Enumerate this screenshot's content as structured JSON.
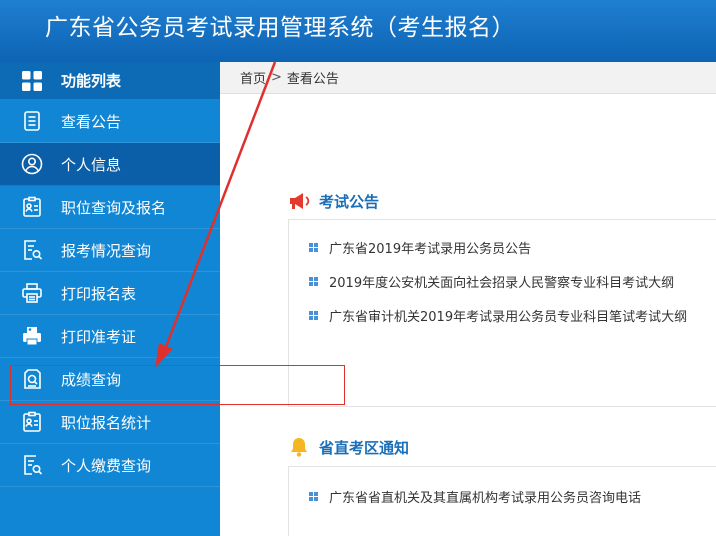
{
  "header": {
    "title": "广东省公务员考试录用管理系统（考生报名）"
  },
  "sidebar": {
    "head_label": "功能列表",
    "items": [
      {
        "label": "查看公告",
        "icon": "document-list-icon"
      },
      {
        "label": "个人信息",
        "icon": "user-circle-icon"
      },
      {
        "label": "职位查询及报名",
        "icon": "id-card-icon"
      },
      {
        "label": "报考情况查询",
        "icon": "document-search-icon"
      },
      {
        "label": "打印报名表",
        "icon": "printer-icon"
      },
      {
        "label": "打印准考证",
        "icon": "printer-id-icon"
      },
      {
        "label": "成绩查询",
        "icon": "score-search-icon"
      },
      {
        "label": "职位报名统计",
        "icon": "id-card-icon"
      },
      {
        "label": "个人缴费查询",
        "icon": "document-search-icon"
      }
    ]
  },
  "breadcrumb": {
    "home": "首页",
    "separator": ">",
    "current": "查看公告"
  },
  "sections": {
    "exam_notice": {
      "title": "考试公告",
      "icon": "megaphone-icon",
      "items": [
        "广东省2019年考试录用公务员公告",
        "2019年度公安机关面向社会招录人民警察专业科目考试大纲",
        "广东省审计机关2019年考试录用公务员专业科目笔试考试大纲"
      ]
    },
    "provincial_notice": {
      "title": "省直考区通知",
      "icon": "bell-icon",
      "items": [
        "广东省省直机关及其直属机构考试录用公务员咨询电话"
      ]
    }
  },
  "colors": {
    "header_bg": "#1471c4",
    "sidebar_bg": "#1186d4",
    "sidebar_active": "#0b5fa8",
    "section_title": "#1a6fb8",
    "annotation_red": "#e0302c"
  }
}
